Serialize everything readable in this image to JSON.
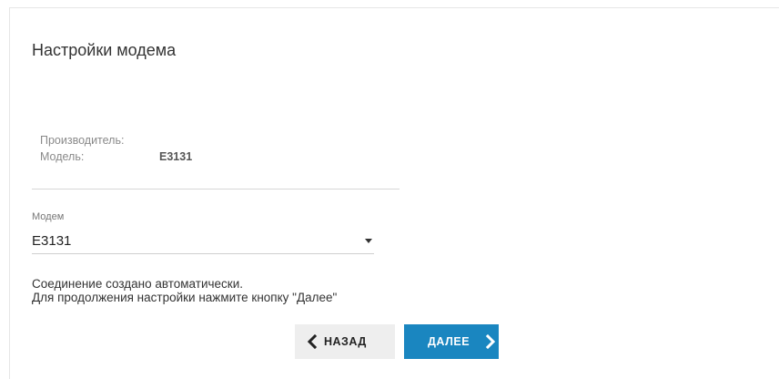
{
  "page": {
    "title": "Настройки модема"
  },
  "modem_info": {
    "manufacturer_label": "Производитель:",
    "manufacturer_value": "",
    "model_label": "Модель:",
    "model_value": "E3131"
  },
  "modem_select": {
    "label": "Модем",
    "selected": "E3131"
  },
  "message": {
    "line1": "Соединение создано автоматически.",
    "line2": "Для продолжения настройки нажмите кнопку \"Далее\""
  },
  "buttons": {
    "back_label": "НАЗАД",
    "next_label": "ДАЛЕЕ"
  },
  "colors": {
    "accent": "#1a86c0",
    "back_button_bg": "#eeeeee"
  },
  "icons": {
    "back": "chevron-left-icon",
    "next": "chevron-right-icon",
    "dropdown": "caret-down-icon"
  }
}
